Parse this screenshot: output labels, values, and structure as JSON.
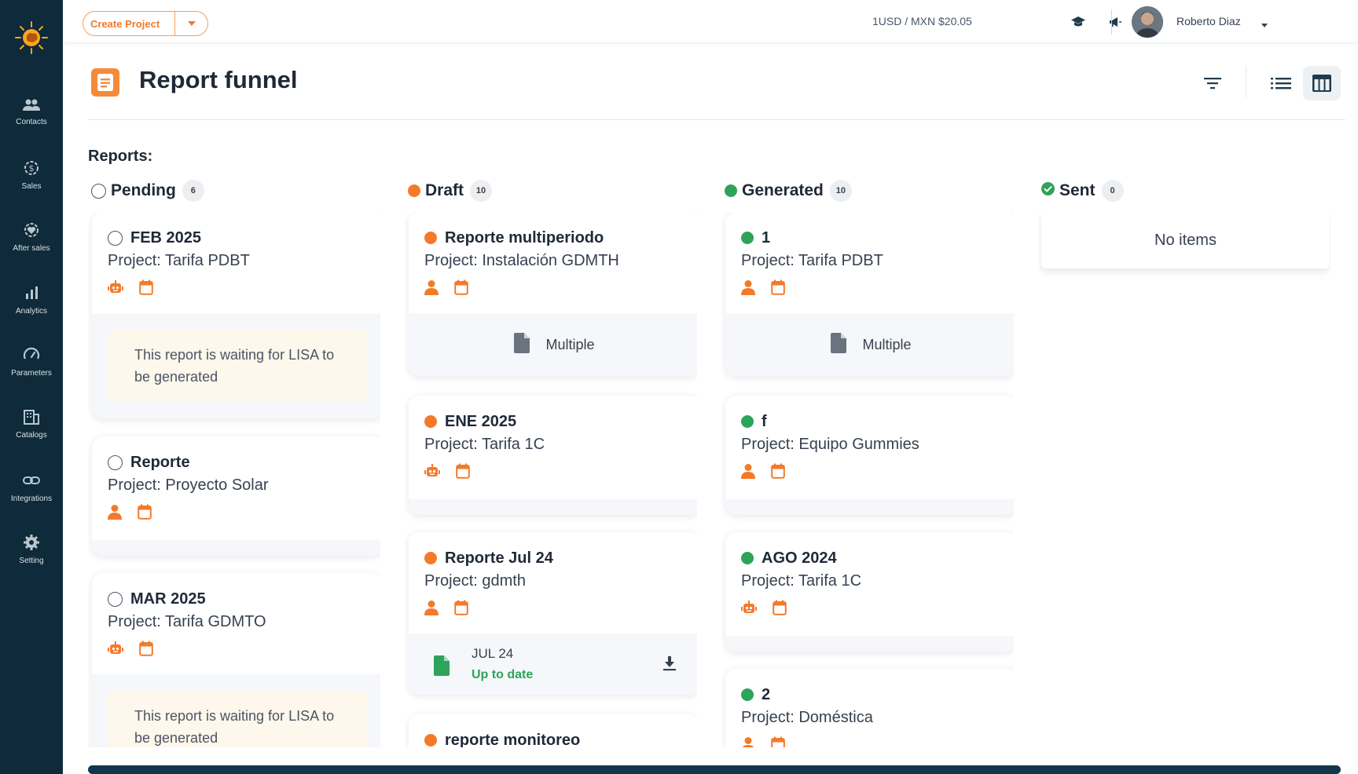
{
  "topbar": {
    "create_label": "Create Project",
    "exchange_rate": "1USD / MXN $20.05",
    "user_name": "Roberto Diaz"
  },
  "sidebar": {
    "items": [
      {
        "label": "Contacts",
        "icon": "contacts-icon"
      },
      {
        "label": "Sales",
        "icon": "sales-icon"
      },
      {
        "label": "After sales",
        "icon": "after-sales-icon"
      },
      {
        "label": "Analytics",
        "icon": "analytics-icon"
      },
      {
        "label": "Parameters",
        "icon": "parameters-icon"
      },
      {
        "label": "Catalogs",
        "icon": "catalogs-icon"
      },
      {
        "label": "Integrations",
        "icon": "integrations-icon"
      },
      {
        "label": "Setting",
        "icon": "setting-icon"
      }
    ]
  },
  "page": {
    "title": "Report funnel",
    "section_label": "Reports:"
  },
  "colors": {
    "accent": "#f47a2a",
    "green": "#2ea35a",
    "sidebar": "#0f2a3a"
  },
  "columns": [
    {
      "title": "Pending",
      "count": "6",
      "cards": [
        {
          "title": "FEB 2025",
          "project": "Project: Tarifa PDBT",
          "owner_icon": "robot-icon",
          "note": "This report is waiting for LISA to be generated"
        },
        {
          "title": "Reporte",
          "project": "Project: Proyecto Solar",
          "owner_icon": "person-icon"
        },
        {
          "title": "MAR 2025",
          "project": "Project: Tarifa GDMTO",
          "owner_icon": "robot-icon",
          "note": "This report is waiting for LISA to be generated"
        }
      ]
    },
    {
      "title": "Draft",
      "count": "10",
      "cards": [
        {
          "title": "Reporte multiperiodo",
          "project": "Project: Instalación GDMTH",
          "owner_icon": "person-icon",
          "file_label": "Multiple"
        },
        {
          "title": "ENE 2025",
          "project": "Project: Tarifa 1C",
          "owner_icon": "robot-icon"
        },
        {
          "title": "Reporte Jul 24",
          "project": "Project: gdmth",
          "owner_icon": "person-icon",
          "file_name": "JUL 24",
          "file_status": "Up to date"
        },
        {
          "title": "reporte monitoreo"
        }
      ]
    },
    {
      "title": "Generated",
      "count": "10",
      "cards": [
        {
          "title": "1",
          "project": "Project: Tarifa PDBT",
          "owner_icon": "person-icon",
          "file_label": "Multiple"
        },
        {
          "title": "f",
          "project": "Project: Equipo Gummies",
          "owner_icon": "person-icon"
        },
        {
          "title": "AGO 2024",
          "project": "Project: Tarifa 1C",
          "owner_icon": "robot-icon"
        },
        {
          "title": "2",
          "project": "Project: Doméstica",
          "owner_icon": "person-icon"
        }
      ]
    },
    {
      "title": "Sent",
      "count": "0",
      "empty_text": "No items"
    }
  ]
}
